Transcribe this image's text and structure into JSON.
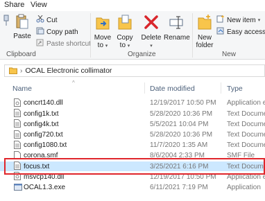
{
  "tabs": [
    "Share",
    "View"
  ],
  "ribbon": {
    "clipboard": {
      "label": "Clipboard",
      "pin": "",
      "paste": "Paste",
      "cut": "Cut",
      "copy_path": "Copy path",
      "paste_shortcut": "Paste shortcut"
    },
    "organize": {
      "label": "Organize",
      "move_to": [
        "Move",
        "to"
      ],
      "copy_to": [
        "Copy",
        "to"
      ],
      "delete": "Delete",
      "rename": "Rename"
    },
    "new": {
      "label": "New",
      "new_folder": [
        "New",
        "folder"
      ],
      "new_item": "New item",
      "easy_access": "Easy access"
    }
  },
  "address": {
    "path": "OCAL Electronic collimator"
  },
  "columns": {
    "name": "Name",
    "date": "Date modified",
    "type": "Type"
  },
  "files": [
    {
      "name": "concrt140.dll",
      "date": "12/19/2017 10:50 PM",
      "type": "Application e",
      "icon": "dll-icon"
    },
    {
      "name": "config1k.txt",
      "date": "5/28/2020 10:36 PM",
      "type": "Text Docume",
      "icon": "txt-icon"
    },
    {
      "name": "config4k.txt",
      "date": "5/5/2021 10:04 PM",
      "type": "Text Docume",
      "icon": "txt-icon"
    },
    {
      "name": "config720.txt",
      "date": "5/28/2020 10:36 PM",
      "type": "Text Docume",
      "icon": "txt-icon"
    },
    {
      "name": "config1080.txt",
      "date": "11/7/2020 1:35 AM",
      "type": "Text Docume",
      "icon": "txt-icon"
    },
    {
      "name": "corona.smf",
      "date": "8/6/2004 2:33 PM",
      "type": "SMF File",
      "icon": "file-icon"
    },
    {
      "name": "focus.txt",
      "date": "3/25/2021 6:16 PM",
      "type": "Text Docume",
      "icon": "txt-icon"
    },
    {
      "name": "msvcp140.dll",
      "date": "12/19/2017 10:50 PM",
      "type": "Application e",
      "icon": "dll-icon"
    },
    {
      "name": "OCAL1.3.exe",
      "date": "6/11/2021 7:19 PM",
      "type": "Application",
      "icon": "exe-icon"
    }
  ],
  "colors": {
    "highlight_box": "#e0252b",
    "selection": "#cce8ff",
    "folder": "#f8c54b",
    "delete_x": "#d9262c"
  }
}
